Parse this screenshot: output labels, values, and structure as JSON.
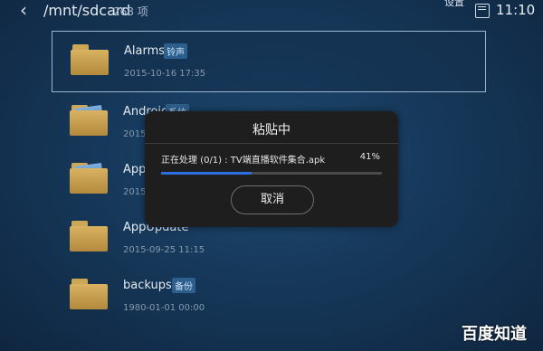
{
  "header": {
    "path": "/mnt/sdcard",
    "count": "268 项",
    "notification": "设置",
    "time": "11:10"
  },
  "files": [
    {
      "name": "Alarms",
      "badge": "铃声",
      "date": "2015-10-16 17:35",
      "selected": true
    },
    {
      "name": "Android",
      "badge": "系统",
      "date": "2015-10-14 11:15"
    },
    {
      "name": "AppManager",
      "badge": "",
      "date": "2015-10-14 11:15"
    },
    {
      "name": "AppUpdate",
      "badge": "",
      "date": "2015-09-25 11:15"
    },
    {
      "name": "backups",
      "badge": "备份",
      "date": "1980-01-01 00:00"
    }
  ],
  "dialog": {
    "title": "粘贴中",
    "processing": "正在处理 (0/1) : TV端直播软件集合.apk",
    "percent": "41%",
    "progress": 0.41,
    "cancel_label": "取消"
  },
  "watermark": "百度知道",
  "colors": {
    "accent": "#2c6fe0",
    "badge": "#2d5f8e"
  }
}
